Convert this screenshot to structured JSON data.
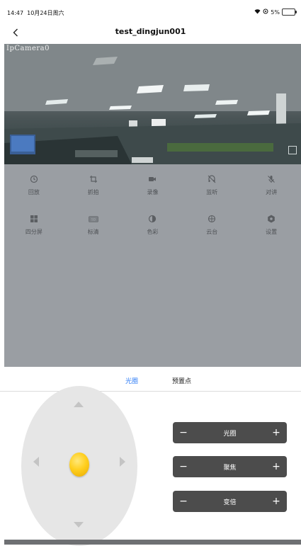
{
  "status_bar": {
    "time": "14:47",
    "date": "10月24日周六",
    "battery": "5%"
  },
  "nav": {
    "title": "test_dingjun001"
  },
  "video": {
    "camera_label": "IpCamera0"
  },
  "controls": {
    "row1": [
      {
        "label": "回放",
        "icon": "playback-icon"
      },
      {
        "label": "抓拍",
        "icon": "crop-icon"
      },
      {
        "label": "录像",
        "icon": "video-record-icon"
      },
      {
        "label": "监听",
        "icon": "listen-muted-icon"
      },
      {
        "label": "对讲",
        "icon": "microphone-muted-icon"
      }
    ],
    "row2": [
      {
        "label": "四分屏",
        "icon": "four-screen-icon"
      },
      {
        "label": "标清",
        "icon": "sd-badge-icon",
        "badge": "SD"
      },
      {
        "label": "色彩",
        "icon": "color-icon"
      },
      {
        "label": "云台",
        "icon": "ptz-icon"
      },
      {
        "label": "设置",
        "icon": "settings-icon"
      }
    ]
  },
  "tabs": [
    {
      "label": "光圈",
      "active": true
    },
    {
      "label": "预置点",
      "active": false
    }
  ],
  "ptz": {
    "adjusters": [
      {
        "label": "光圈",
        "minus": "−",
        "plus": "+"
      },
      {
        "label": "聚焦",
        "minus": "−",
        "plus": "+"
      },
      {
        "label": "变倍",
        "minus": "−",
        "plus": "+"
      }
    ]
  },
  "colors": {
    "accent": "#2f7df6",
    "control_bg": "#9a9ea3",
    "adjuster_bg": "#4c4c4c",
    "knob": "#ffcf1f"
  }
}
